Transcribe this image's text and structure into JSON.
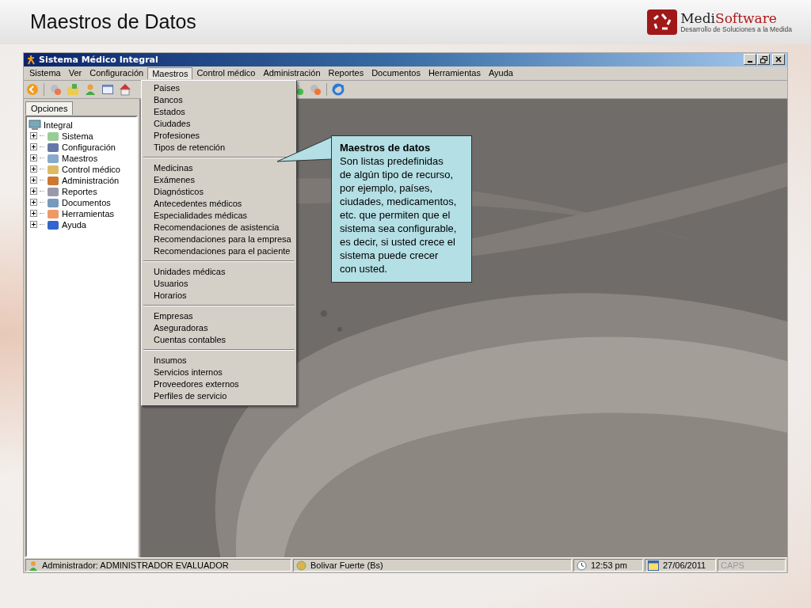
{
  "slide": {
    "title": "Maestros de Datos",
    "logo": {
      "wordmark": [
        "Medi",
        "Software"
      ],
      "tagline": "Desarrollo de Soluciones a la Medida"
    }
  },
  "window": {
    "title": "Sistema Médico Integral"
  },
  "menu_bar": [
    {
      "label": "Sistema",
      "selected": false
    },
    {
      "label": "Ver",
      "selected": false
    },
    {
      "label": "Configuración",
      "selected": false
    },
    {
      "label": "Maestros",
      "selected": true
    },
    {
      "label": "Control médico",
      "selected": false
    },
    {
      "label": "Administración",
      "selected": false
    },
    {
      "label": "Reportes",
      "selected": false
    },
    {
      "label": "Documentos",
      "selected": false
    },
    {
      "label": "Herramientas",
      "selected": false
    },
    {
      "label": "Ayuda",
      "selected": false
    }
  ],
  "dropdown": [
    [
      "Paises",
      "Bancos",
      "Estados",
      "Ciudades",
      "Profesiones",
      "Tipos de retención"
    ],
    [
      "Medicinas",
      "Exámenes",
      "Diagnósticos",
      "Antecedentes médicos",
      "Especialidades médicas",
      "Recomendaciones de asistencia",
      "Recomendaciones para la empresa",
      "Recomendaciones para el paciente"
    ],
    [
      "Unidades médicas",
      "Usuarios",
      "Horarios"
    ],
    [
      "Empresas",
      "Aseguradoras",
      "Cuentas contables"
    ],
    [
      "Insumos",
      "Servicios internos",
      "Proveedores externos",
      "Perfiles de servicio"
    ]
  ],
  "side_panel": {
    "tab": "Opciones",
    "tree": {
      "label": "Integral",
      "children": [
        {
          "label": "Sistema",
          "expanded": false
        },
        {
          "label": "Configuración",
          "expanded": false
        },
        {
          "label": "Maestros",
          "expanded": false
        },
        {
          "label": "Control médico",
          "expanded": false
        },
        {
          "label": "Administración",
          "expanded": false
        },
        {
          "label": "Reportes",
          "expanded": false
        },
        {
          "label": "Documentos",
          "expanded": false
        },
        {
          "label": "Herramientas",
          "expanded": false
        },
        {
          "label": "Ayuda",
          "expanded": false
        }
      ]
    }
  },
  "callout": {
    "title": "Maestros de datos",
    "body": "Son listas predefinidas de algún tipo de recurso, por ejemplo, países, ciudades, medicamentos, etc. que permiten que el sistema sea configurable, es decir, si usted crece el sistema puede crecer con usted."
  },
  "status_bar": [
    {
      "text": "Administrador: ADMINISTRADOR EVALUADOR",
      "kind": "user",
      "disabled": false
    },
    {
      "text": "Bolivar Fuerte (Bs)",
      "kind": "currency",
      "disabled": false
    },
    {
      "text": "12:53 pm",
      "kind": "time",
      "disabled": false
    },
    {
      "text": "27/06/2011",
      "kind": "date",
      "disabled": false
    },
    {
      "text": "CAPS",
      "kind": "plain",
      "disabled": true
    }
  ]
}
